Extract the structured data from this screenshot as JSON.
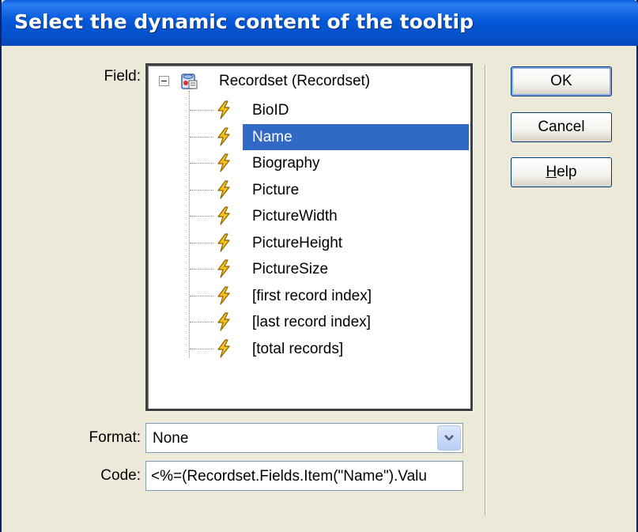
{
  "dialog": {
    "title": "Select the dynamic content of the tooltip"
  },
  "field": {
    "label": "Field:",
    "root": {
      "label": "Recordset (Recordset)",
      "expanded": true,
      "icon": "recordset-icon"
    },
    "items": [
      {
        "label": "BioID",
        "selected": false
      },
      {
        "label": "Name",
        "selected": true
      },
      {
        "label": "Biography",
        "selected": false
      },
      {
        "label": "Picture",
        "selected": false
      },
      {
        "label": "PictureWidth",
        "selected": false
      },
      {
        "label": "PictureHeight",
        "selected": false
      },
      {
        "label": "PictureSize",
        "selected": false
      },
      {
        "label": "[first record index]",
        "selected": false
      },
      {
        "label": "[last record index]",
        "selected": false
      },
      {
        "label": "[total records]",
        "selected": false
      }
    ],
    "item_icon": "lightning-bolt-icon"
  },
  "format": {
    "label": "Format:",
    "value": "None"
  },
  "code": {
    "label": "Code:",
    "value": "<%=(Recordset.Fields.Item(\"Name\").Valu"
  },
  "buttons": {
    "ok": "OK",
    "cancel": "Cancel",
    "help_mnemonic": "H",
    "help_rest": "elp"
  },
  "colors": {
    "titlebar": "#0558d8",
    "selection": "#316ac5",
    "dialog_bg": "#ece9d8"
  }
}
